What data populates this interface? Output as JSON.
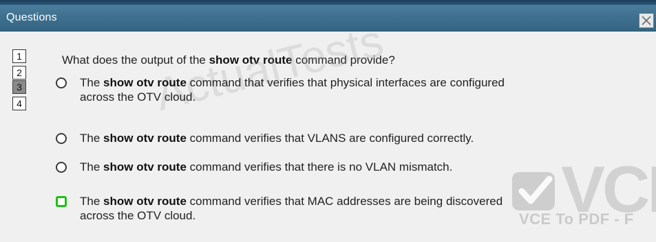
{
  "window": {
    "title": "Questions",
    "close_label": "X"
  },
  "question_nav": [
    "1",
    "2",
    "3",
    "4"
  ],
  "active_question": "3",
  "question": {
    "prefix": "What does the output of the ",
    "command": "show otv route",
    "suffix": " command provide?"
  },
  "options": [
    {
      "pre": "The ",
      "cmd": "show otv route",
      "post_line1": " command that verifies that physical interfaces are configured",
      "line2": "across the OTV cloud.",
      "correct": false
    },
    {
      "pre": "The ",
      "cmd": "show otv route",
      "post_line1": " command verifies that VLANS are configured correctly.",
      "line2": "",
      "correct": false
    },
    {
      "pre": "The ",
      "cmd": "show otv route",
      "post_line1": " command verifies that there is no VLAN mismatch.",
      "line2": "",
      "correct": false
    },
    {
      "pre": "The ",
      "cmd": "show otv route",
      "post_line1": " command verifies that MAC addresses are being discovered",
      "line2": "across the OTV cloud.",
      "correct": true
    }
  ],
  "watermarks": {
    "actual_tests": "ActualTests",
    "vce_big": "VCI",
    "vce_small": "VCE To PDF - F"
  },
  "colors": {
    "titlebar": "#3f708f",
    "correct_marker": "#19c40f"
  }
}
